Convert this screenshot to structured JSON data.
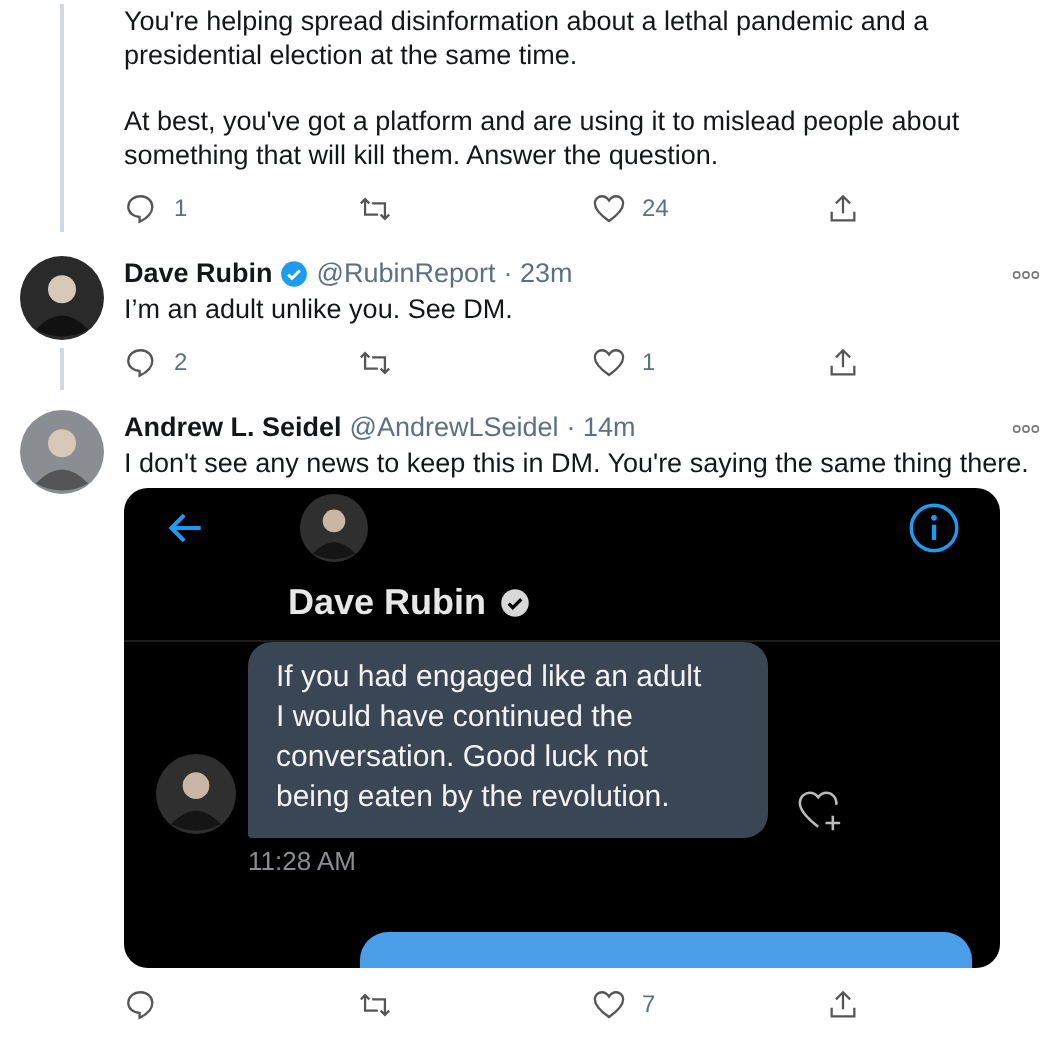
{
  "tweets": [
    {
      "kind": "continuation",
      "paragraphs": [
        "You're helping spread disinformation about a lethal pandemic and a\npresidential election at the same time.",
        "At best, you've got a platform and are using it to mislead people about\nsomething that will kill them. Answer the question."
      ],
      "actions": {
        "replies": "1",
        "likes": "24"
      }
    },
    {
      "kind": "reply",
      "author": "Dave Rubin",
      "verified": true,
      "handle": "@RubinReport",
      "time": "· 23m",
      "text": "I’m an adult unlike you. See DM.",
      "actions": {
        "replies": "2",
        "likes": "1"
      }
    },
    {
      "kind": "reply",
      "author": "Andrew L. Seidel",
      "verified": false,
      "handle": "@AndrewLSeidel",
      "time": "· 14m",
      "text": "I don't see any news to keep this in DM. You're saying the same thing there.",
      "embed": {
        "contact": "Dave Rubin",
        "verified": true,
        "message": "If you had engaged like an adult\nI would have continued the\nconversation. Good luck not\nbeing eaten by the revolution.",
        "message_time": "11:28 AM"
      },
      "actions": {
        "likes": "7"
      }
    }
  ]
}
